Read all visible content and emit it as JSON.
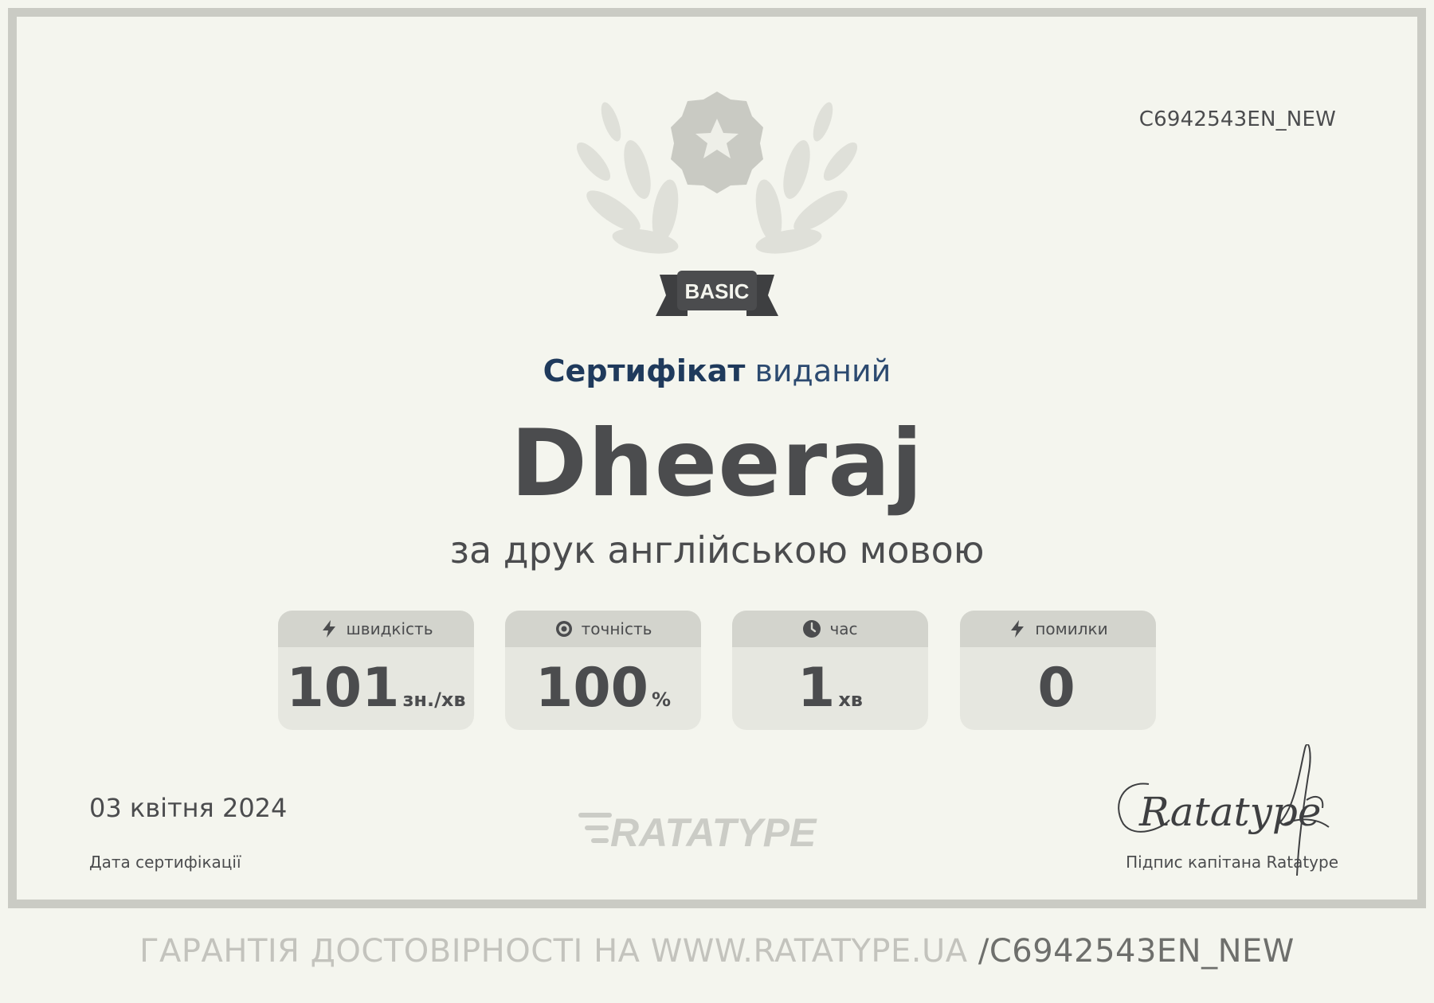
{
  "certificate": {
    "id": "C6942543EN_NEW",
    "level_badge": "BASIC",
    "headline_strong": "Сертифікат",
    "headline_soft": "виданий",
    "recipient_name": "Dheeraj",
    "subtitle": "за друк англійською мовою"
  },
  "stats": [
    {
      "label": "швидкість",
      "value": "101",
      "unit": "зн./хв",
      "icon": "lightning-icon"
    },
    {
      "label": "точність",
      "value": "100",
      "unit": "%",
      "icon": "target-icon"
    },
    {
      "label": "час",
      "value": "1",
      "unit": "хв",
      "icon": "clock-icon"
    },
    {
      "label": "помилки",
      "value": "0",
      "unit": "",
      "icon": "lightning-icon"
    }
  ],
  "date": {
    "value": "03 квітня 2024",
    "label": "Дата сертифікації"
  },
  "brand": {
    "logo_text": "RATATYPE"
  },
  "signature": {
    "script": "Ratatype",
    "label": "Підпис капітана Ratatype"
  },
  "footer": {
    "text": "ГАРАНТІЯ ДОСТОВІРНОСТІ НА WWW.RATATYPE.UA",
    "id_suffix": "/C6942543EN_NEW"
  }
}
